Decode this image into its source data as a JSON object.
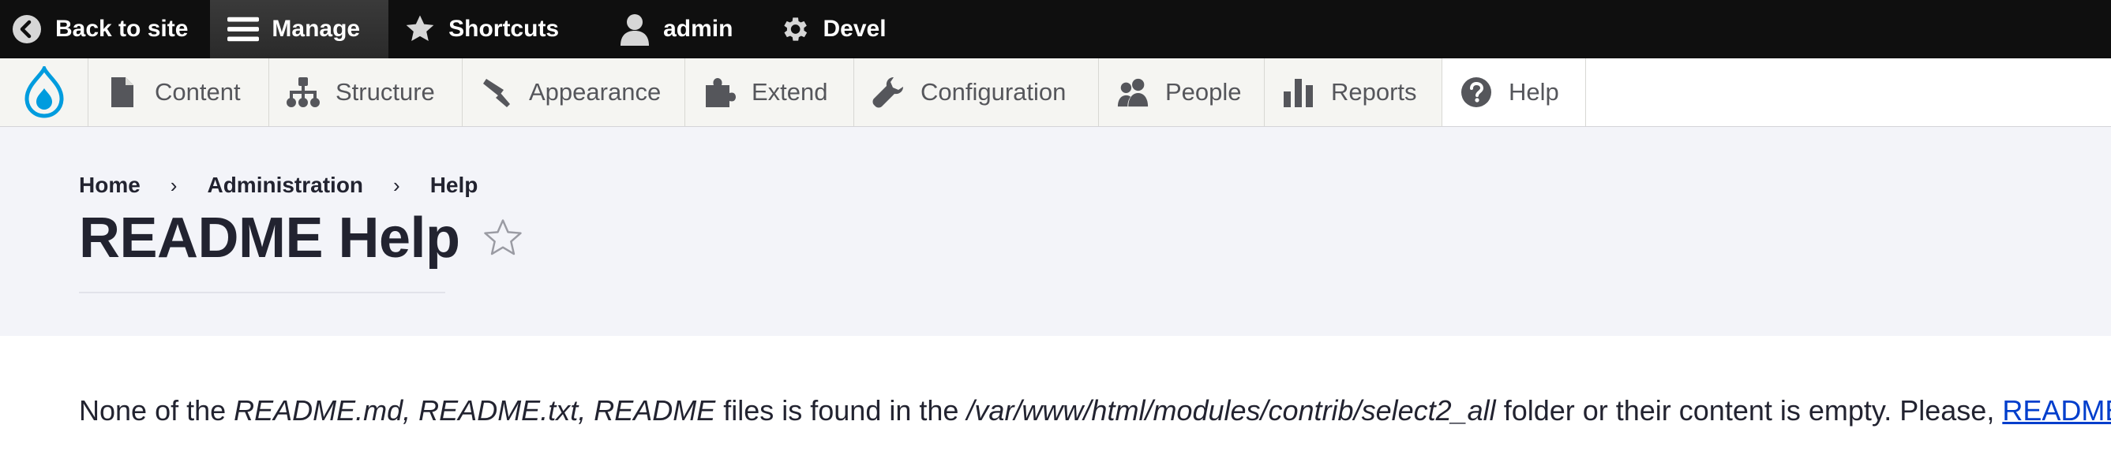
{
  "toolbar": {
    "back_to_site": "Back to site",
    "manage": "Manage",
    "shortcuts": "Shortcuts",
    "user": "admin",
    "devel": "Devel"
  },
  "tray": {
    "items": [
      {
        "label": "Content",
        "icon": "document-icon"
      },
      {
        "label": "Structure",
        "icon": "sitemap-icon"
      },
      {
        "label": "Appearance",
        "icon": "paintbrush-icon"
      },
      {
        "label": "Extend",
        "icon": "puzzle-icon"
      },
      {
        "label": "Configuration",
        "icon": "wrench-icon"
      },
      {
        "label": "People",
        "icon": "people-icon"
      },
      {
        "label": "Reports",
        "icon": "bar-chart-icon"
      },
      {
        "label": "Help",
        "icon": "help-icon"
      }
    ]
  },
  "breadcrumb": {
    "home": "Home",
    "administration": "Administration",
    "help": "Help",
    "separator": "›"
  },
  "page": {
    "title": "README Help"
  },
  "message": {
    "part1": "None of the ",
    "files": "README.md, README.txt, README",
    "part2": " files is found in the ",
    "path": "/var/www/html/modules/contrib/select2_all",
    "part3": " folder or their content is empty. Please, ",
    "link": "README",
    "part4": "."
  },
  "colors": {
    "toolbar_bg": "#0f0f0f",
    "tray_bg": "#f5f5f2",
    "header_bg": "#f3f4f9",
    "link": "#003ecc",
    "drupal_blue": "#009cde"
  }
}
